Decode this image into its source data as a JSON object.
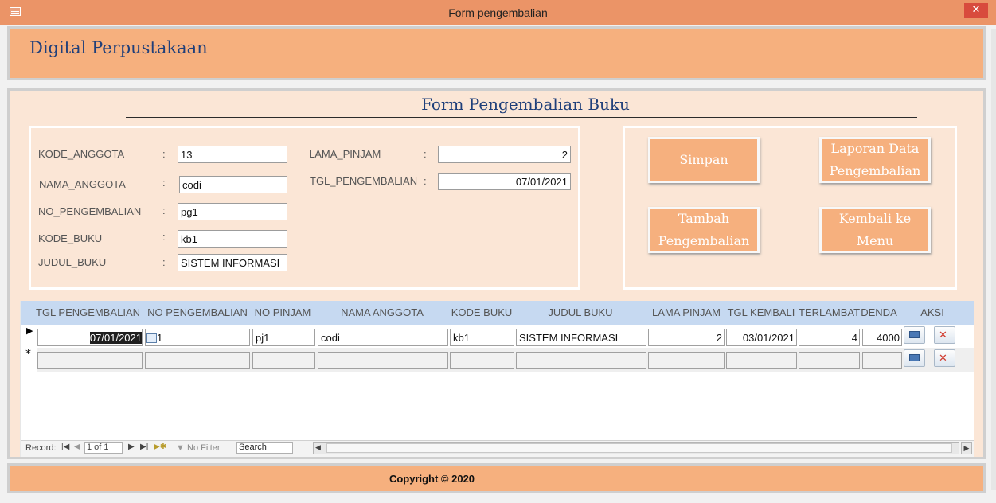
{
  "window": {
    "title": "Form pengembalian",
    "close_glyph": "✕"
  },
  "header": {
    "app_title": "Digital Perpustakaan"
  },
  "form": {
    "title": "Form Pengembalian Buku",
    "fields": {
      "kode_anggota": {
        "label": "KODE_ANGGOTA",
        "value": "13"
      },
      "nama_anggota": {
        "label": "NAMA_ANGGOTA",
        "value": "codi"
      },
      "no_pengembalian": {
        "label": "NO_PENGEMBALIAN",
        "value": "pg1"
      },
      "kode_buku": {
        "label": "KODE_BUKU",
        "value": "kb1"
      },
      "judul_buku": {
        "label": "JUDUL_BUKU",
        "value": "SISTEM INFORMASI"
      },
      "lama_pinjam": {
        "label": "LAMA_PINJAM",
        "value": "2"
      },
      "tgl_pengembalian": {
        "label": "TGL_PENGEMBALIAN",
        "value": "07/01/2021"
      }
    },
    "colon": ":",
    "buttons": {
      "simpan": "Simpan",
      "laporan": "Laporan Data Pengembalian",
      "tambah": "Tambah Pengembalian",
      "kembali": "Kembali ke Menu"
    }
  },
  "subform": {
    "columns": [
      "TGL PENGEMBALIAN",
      "NO PENGEMBALIAN",
      "NO PINJAM",
      "NAMA ANGGOTA",
      "KODE BUKU",
      "JUDUL BUKU",
      "LAMA PINJAM",
      "TGL KEMBALI",
      "TERLAMBAT",
      "DENDA",
      "AKSI"
    ],
    "rows": [
      {
        "tgl_pengembalian": "07/01/2021",
        "no_pengembalian": "pg1",
        "no_pengembalian_visible": "1",
        "no_pinjam": "pj1",
        "nama_anggota": "codi",
        "kode_buku": "kb1",
        "judul_buku": "SISTEM INFORMASI",
        "lama_pinjam": "2",
        "tgl_kembali": "03/01/2021",
        "terlambat": "4",
        "denda": "4000"
      }
    ],
    "current_row_marker": "▶",
    "new_row_marker": "*",
    "navigation": {
      "record_label": "Record:",
      "record_position": "1 of 1",
      "filter_label": "No Filter",
      "search_placeholder": "Search"
    }
  },
  "footer": {
    "copyright": "Copyright © 2020"
  },
  "colors": {
    "titlebar": "#eb9467",
    "band": "#f6b07e",
    "detail_bg": "#fbe6d6",
    "title_text": "#1f3f7a",
    "grid_header": "#c6d9f1"
  }
}
